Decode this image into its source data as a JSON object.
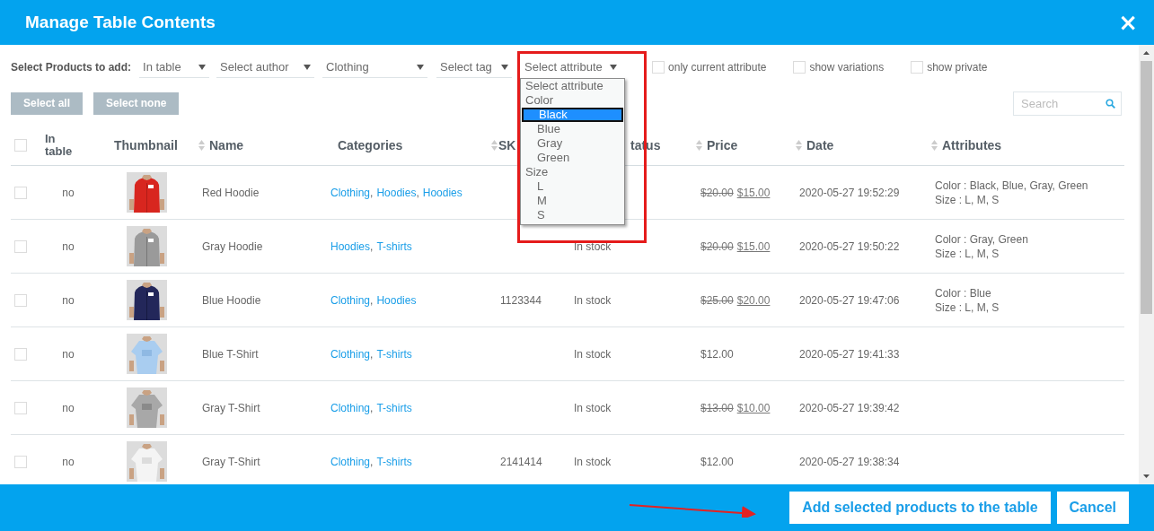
{
  "window": {
    "title": "Manage Table Contents",
    "close": "×"
  },
  "filters": {
    "label": "Select Products to add:",
    "selects": [
      {
        "value": "In table",
        "kind": "select"
      },
      {
        "value": "Select author",
        "kind": "select"
      },
      {
        "value": "Clothing",
        "kind": "select"
      },
      {
        "value": "Select tag",
        "kind": "select"
      },
      {
        "value": "Select attribute",
        "kind": "select",
        "expanded": true
      }
    ],
    "checkboxes": [
      {
        "label": "only current attribute",
        "checked": false
      },
      {
        "label": "show variations",
        "checked": false
      },
      {
        "label": "show private",
        "checked": false
      }
    ]
  },
  "attribute_dropdown": {
    "options": [
      {
        "label": "Select attribute",
        "kind": "group",
        "selected": false
      },
      {
        "label": "Color",
        "kind": "group",
        "selected": false
      },
      {
        "label": "Black",
        "kind": "option",
        "selected": true
      },
      {
        "label": "Blue",
        "kind": "option",
        "selected": false
      },
      {
        "label": "Gray",
        "kind": "option",
        "selected": false
      },
      {
        "label": "Green",
        "kind": "option",
        "selected": false
      },
      {
        "label": "Size",
        "kind": "group",
        "selected": false
      },
      {
        "label": "L",
        "kind": "option",
        "selected": false
      },
      {
        "label": "M",
        "kind": "option",
        "selected": false
      },
      {
        "label": "S",
        "kind": "option",
        "selected": false
      }
    ]
  },
  "buttons": [
    "Select all",
    "Select none"
  ],
  "search": {
    "placeholder": "Search"
  },
  "table": {
    "select_all_checked": false,
    "category_separator": ",",
    "columns": [
      {
        "label": "In table",
        "sortable": false
      },
      {
        "label": "Thumbnail",
        "sortable": false
      },
      {
        "label": "Name",
        "sortable": true
      },
      {
        "label": "Categories",
        "sortable": false
      },
      {
        "label": "SK",
        "sortable": true
      },
      {
        "label": "tatus",
        "sortable": false
      },
      {
        "label": "Price",
        "sortable": true
      },
      {
        "label": "Date",
        "sortable": true
      },
      {
        "label": "Attributes",
        "sortable": true
      }
    ],
    "rows": [
      {
        "checked": false,
        "in_table": "no",
        "thumbnail": {
          "kind": "picture"
        },
        "name": "Red Hoodie",
        "categories": [
          "Clothing",
          "Hoodies",
          "Hoodies"
        ],
        "regular_price": "$20.00",
        "price": "$15.00",
        "date": "2020-05-27 19:52:29",
        "attributes": [
          "Color : Black, Blue, Gray, Green",
          "Size : L, M, S"
        ]
      },
      {
        "checked": false,
        "in_table": "no",
        "thumbnail": {
          "kind": "picture"
        },
        "name": "Gray Hoodie",
        "categories": [
          "Hoodies",
          "T-shirts"
        ],
        "status": "In stock",
        "regular_price": "$20.00",
        "price": "$15.00",
        "date": "2020-05-27 19:50:22",
        "attributes": [
          "Color : Gray, Green",
          "Size : L, M, S"
        ]
      },
      {
        "checked": false,
        "in_table": "no",
        "thumbnail": {
          "kind": "picture"
        },
        "name": "Blue Hoodie",
        "categories": [
          "Clothing",
          "Hoodies"
        ],
        "sku": "1123344",
        "status": "In stock",
        "regular_price": "$25.00",
        "price": "$20.00",
        "date": "2020-05-27 19:47:06",
        "attributes": [
          "Color : Blue",
          "Size : L, M, S"
        ]
      },
      {
        "checked": false,
        "in_table": "no",
        "thumbnail": {
          "kind": "picture"
        },
        "name": "Blue T-Shirt",
        "categories": [
          "Clothing",
          "T-shirts"
        ],
        "status": "In stock",
        "price": "$12.00",
        "date": "2020-05-27 19:41:33"
      },
      {
        "checked": false,
        "in_table": "no",
        "thumbnail": {
          "kind": "picture"
        },
        "name": "Gray T-Shirt",
        "categories": [
          "Clothing",
          "T-shirts"
        ],
        "status": "In stock",
        "regular_price": "$13.00",
        "price": "$10.00",
        "date": "2020-05-27 19:39:42"
      },
      {
        "checked": false,
        "in_table": "no",
        "thumbnail": {
          "kind": "picture"
        },
        "name": "Gray T-Shirt",
        "categories": [
          "Clothing",
          "T-shirts"
        ],
        "sku": "2141414",
        "status": "In stock",
        "price": "$12.00",
        "date": "2020-05-27 19:38:34"
      }
    ]
  },
  "footer_buttons": [
    "Add selected products to the table",
    "Cancel"
  ]
}
